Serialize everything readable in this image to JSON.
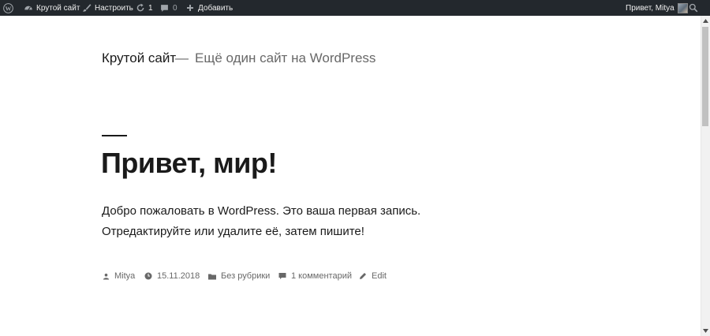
{
  "adminbar": {
    "site_label": "Крутой сайт",
    "customize_label": "Настроить",
    "updates_count": "1",
    "comments_count": "0",
    "add_label": "Добавить",
    "greeting": "Привет, Mitya"
  },
  "site": {
    "title": "Крутой сайт",
    "separator": "—",
    "description": "Ещё один сайт на WordPress"
  },
  "post": {
    "title": "Привет, мир!",
    "paragraph_1": "Добро пожаловать в WordPress. Это ваша первая запись.",
    "paragraph_2": "Отредактируйте или удалите её, затем пишите!",
    "meta": {
      "author": "Mitya",
      "date": "15.11.2018",
      "category": "Без рубрики",
      "comments": "1 комментарий",
      "edit": "Edit"
    }
  },
  "colors": {
    "adminbar_bg": "#23282d",
    "text": "#1a1a1a",
    "secondary_text": "#686868"
  }
}
